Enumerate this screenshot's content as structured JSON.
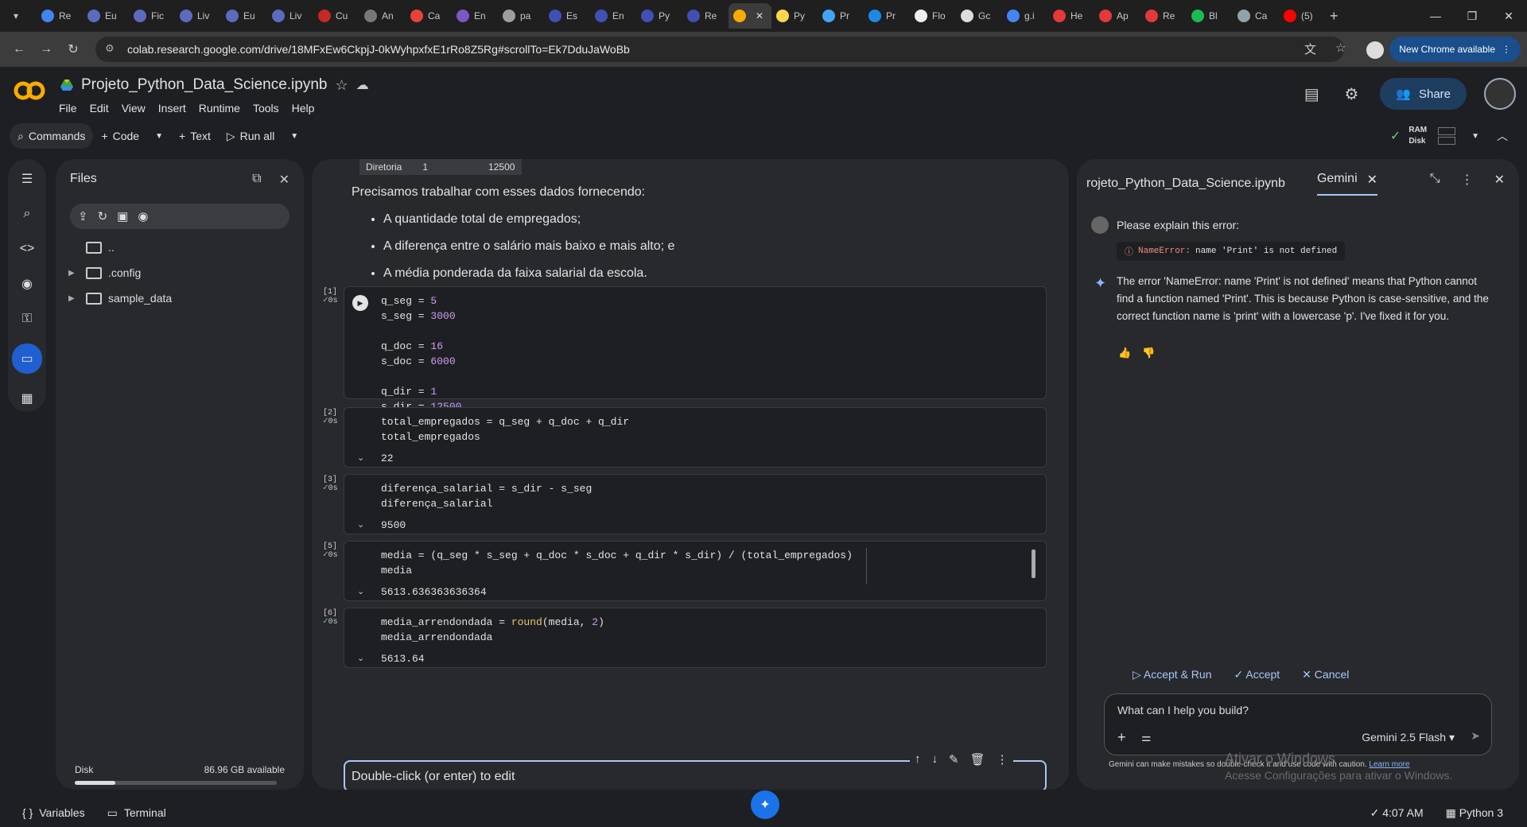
{
  "browser": {
    "tabs": [
      {
        "label": "Re",
        "color": "#4285f4"
      },
      {
        "label": "Eu",
        "color": "#5c6bc0"
      },
      {
        "label": "Fic",
        "color": "#5c6bc0"
      },
      {
        "label": "Liv",
        "color": "#5c6bc0"
      },
      {
        "label": "Eu",
        "color": "#5c6bc0"
      },
      {
        "label": "Liv",
        "color": "#5c6bc0"
      },
      {
        "label": "Cu",
        "color": "#c62828"
      },
      {
        "label": "An",
        "color": "#777777"
      },
      {
        "label": "Ca",
        "color": "#ea4335"
      },
      {
        "label": "En",
        "color": "#7e57c2"
      },
      {
        "label": "pa",
        "color": "#9e9e9e"
      },
      {
        "label": "Es",
        "color": "#3f51b5"
      },
      {
        "label": "En",
        "color": "#3f51b5"
      },
      {
        "label": "Py",
        "color": "#3f51b5"
      },
      {
        "label": "Re",
        "color": "#3f51b5"
      },
      {
        "label": "",
        "color": "#f9ab00",
        "active": true
      },
      {
        "label": "Py",
        "color": "#ffd54f"
      },
      {
        "label": "Pr",
        "color": "#42a5f5"
      },
      {
        "label": "Pr",
        "color": "#1e88e5"
      },
      {
        "label": "Flo",
        "color": "#eeeeee"
      },
      {
        "label": "Gc",
        "color": "#dddddd"
      },
      {
        "label": "g.i",
        "color": "#4285f4"
      },
      {
        "label": "He",
        "color": "#e53935"
      },
      {
        "label": "Ap",
        "color": "#e53935"
      },
      {
        "label": "Re",
        "color": "#e53935"
      },
      {
        "label": "Bl",
        "color": "#1db954"
      },
      {
        "label": "Ca",
        "color": "#90a4ae"
      },
      {
        "label": "(5)",
        "color": "#ff0000"
      }
    ],
    "url": "colab.research.google.com/drive/18MFxEw6CkpjJ-0kWyhpxfxE1rRo8Z5Rg#scrollTo=Ek7DduJaWoBb",
    "update_label": "New Chrome available"
  },
  "header": {
    "notebook_title": "Projeto_Python_Data_Science.ipynb",
    "menus": [
      "File",
      "Edit",
      "View",
      "Insert",
      "Runtime",
      "Tools",
      "Help"
    ],
    "share_label": "Share"
  },
  "commandbar": {
    "commands": "Commands",
    "code": "Code",
    "text": "Text",
    "run_all": "Run all",
    "ram": "RAM",
    "disk": "Disk"
  },
  "files": {
    "title": "Files",
    "items": [
      {
        "name": "..",
        "expandable": false
      },
      {
        "name": ".config",
        "expandable": true
      },
      {
        "name": "sample_data",
        "expandable": true
      }
    ],
    "disk_label": "Disk",
    "disk_available": "86.96 GB available",
    "disk_used_fraction": 0.2
  },
  "notebook": {
    "table_fragment": [
      "Diretoria",
      "1",
      "12500"
    ],
    "markdown_intro": "Precisamos trabalhar com esses dados fornecendo:",
    "markdown_bullets": [
      "A quantidade total de empregados;",
      "A diferença entre o salário mais baixo e mais alto; e",
      "A média ponderada da faixa salarial da escola."
    ],
    "cells": [
      {
        "num": "[1]",
        "time": "0s",
        "output": ""
      },
      {
        "num": "[2]",
        "time": "0s",
        "output": "22"
      },
      {
        "num": "[3]",
        "time": "0s",
        "output": "9500"
      },
      {
        "num": "[5]",
        "time": "0s",
        "output": "5613.636363636364"
      },
      {
        "num": "[6]",
        "time": "0s",
        "output": "5613.64"
      }
    ],
    "text_cell_placeholder": "Double-click (or enter) to edit"
  },
  "gemini": {
    "tab_notebook": "rojeto_Python_Data_Science.ipynb",
    "tab_gemini": "Gemini",
    "user_message": "Please explain this error:",
    "error_chip_type": "NameError:",
    "error_chip_msg": "name 'Print' is not defined",
    "ai_response": "The error 'NameError: name 'Print' is not defined' means that Python cannot find a function named 'Print'. This is because Python is case-sensitive, and the correct function name is 'print' with a lowercase 'p'. I've fixed it for you.",
    "accept_run": "Accept & Run",
    "accept": "Accept",
    "cancel": "Cancel",
    "input_placeholder": "What can I help you build?",
    "model": "Gemini 2.5 Flash",
    "disclaimer": "Gemini can make mistakes so double-check it and use code with caution.",
    "learn_more": "Learn more"
  },
  "watermark": {
    "line1": "Ativar o Windows",
    "line2": "Acesse Configurações para ativar o Windows."
  },
  "statusbar": {
    "variables": "Variables",
    "terminal": "Terminal",
    "time": "4:07 AM",
    "kernel": "Python 3"
  }
}
